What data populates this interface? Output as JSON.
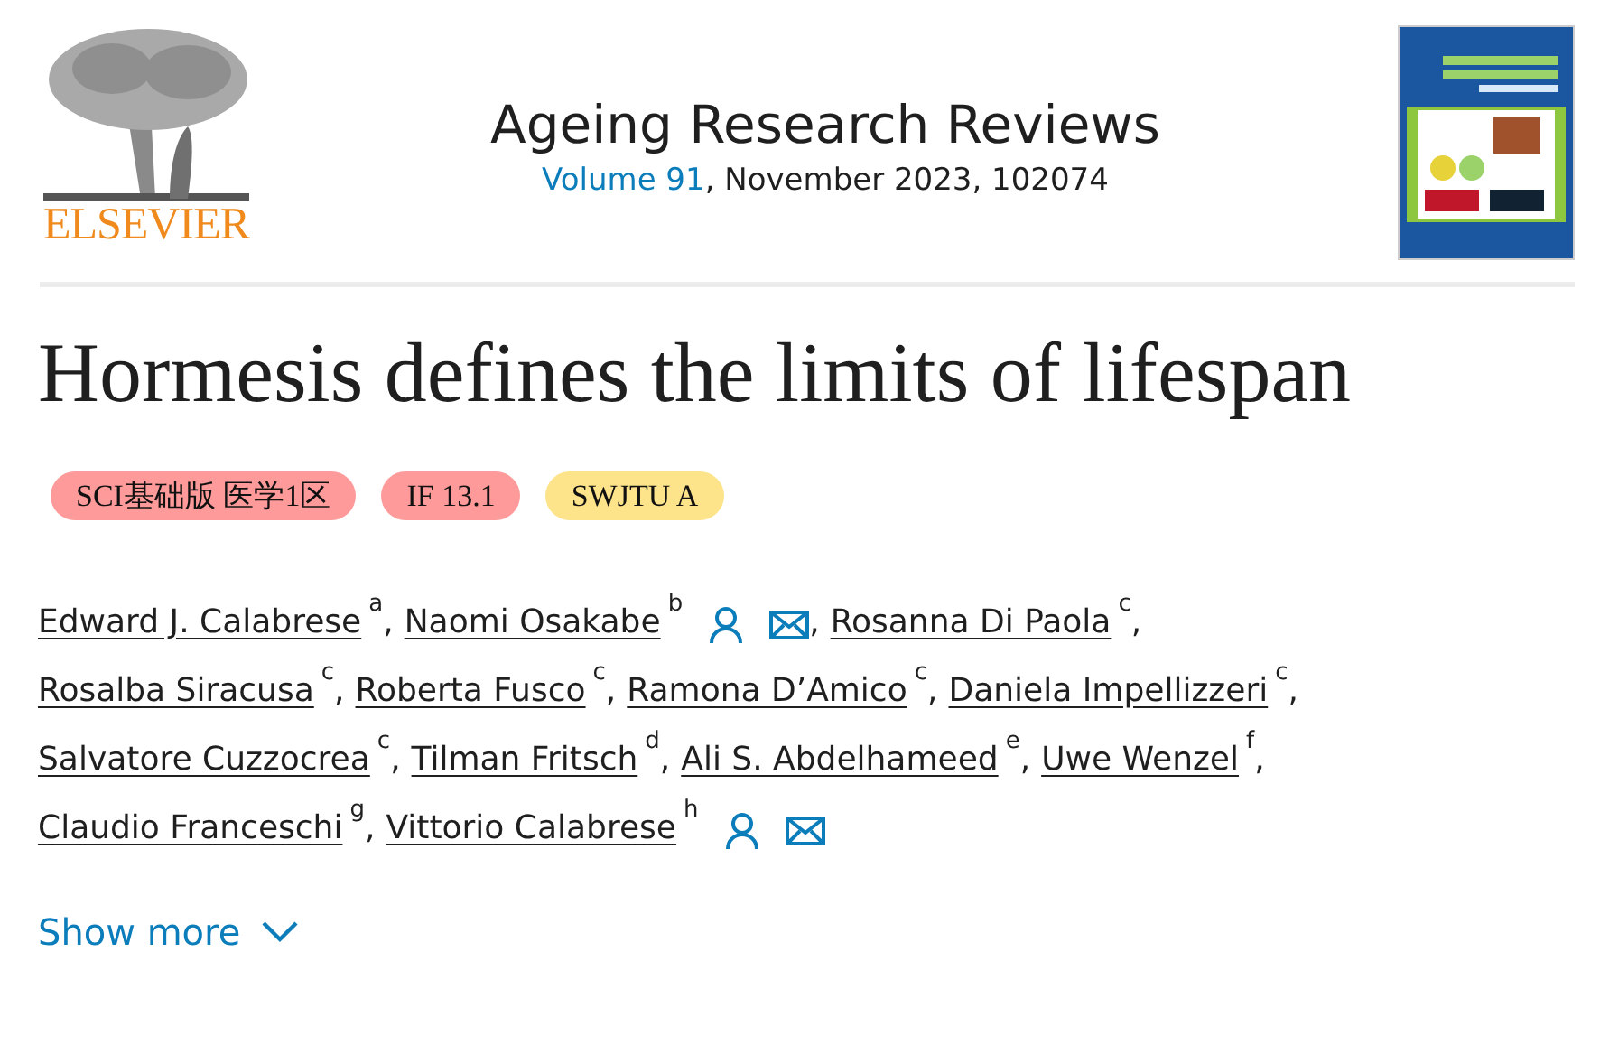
{
  "publisher": {
    "logo_text": "ELSEVIER"
  },
  "journal": {
    "title": "Ageing Research Reviews",
    "volume_link": "Volume 91",
    "details": ", November 2023, 102074"
  },
  "article": {
    "title": "Hormesis defines the limits of lifespan"
  },
  "badges": [
    {
      "text": "SCI基础版 医学1区",
      "color": "#fe9a9a"
    },
    {
      "text": "IF 13.1",
      "color": "#fe9a9a"
    },
    {
      "text": "SWJTU A",
      "color": "#fde38a"
    }
  ],
  "author_lines": [
    [
      {
        "name": "Edward J. Calabrese",
        "affiliation": "a",
        "separator": ","
      },
      {
        "name": "Naomi Osakabe",
        "affiliation": "b",
        "separator": ",",
        "contact_icons": [
          {
            "kind": "person"
          },
          {
            "kind": "email"
          }
        ]
      },
      {
        "name": "Rosanna Di Paola",
        "affiliation": "c",
        "separator": ","
      }
    ],
    [
      {
        "name": "Rosalba Siracusa",
        "affiliation": "c",
        "separator": ","
      },
      {
        "name": "Roberta Fusco",
        "affiliation": "c",
        "separator": ","
      },
      {
        "name": "Ramona D’Amico",
        "affiliation": "c",
        "separator": ","
      },
      {
        "name": "Daniela Impellizzeri",
        "affiliation": "c",
        "separator": ","
      }
    ],
    [
      {
        "name": "Salvatore Cuzzocrea",
        "affiliation": "c",
        "separator": ","
      },
      {
        "name": "Tilman Fritsch",
        "affiliation": "d",
        "separator": ","
      },
      {
        "name": "Ali S. Abdelhameed",
        "affiliation": "e",
        "separator": ","
      },
      {
        "name": "Uwe Wenzel",
        "affiliation": "f",
        "separator": ","
      }
    ],
    [
      {
        "name": "Claudio Franceschi",
        "affiliation": "g",
        "separator": ","
      },
      {
        "name": "Vittorio Calabrese",
        "affiliation": "h",
        "contact_icons": [
          {
            "kind": "person"
          },
          {
            "kind": "email"
          }
        ]
      }
    ]
  ],
  "show_more": {
    "label": "Show more",
    "expanded": false
  }
}
